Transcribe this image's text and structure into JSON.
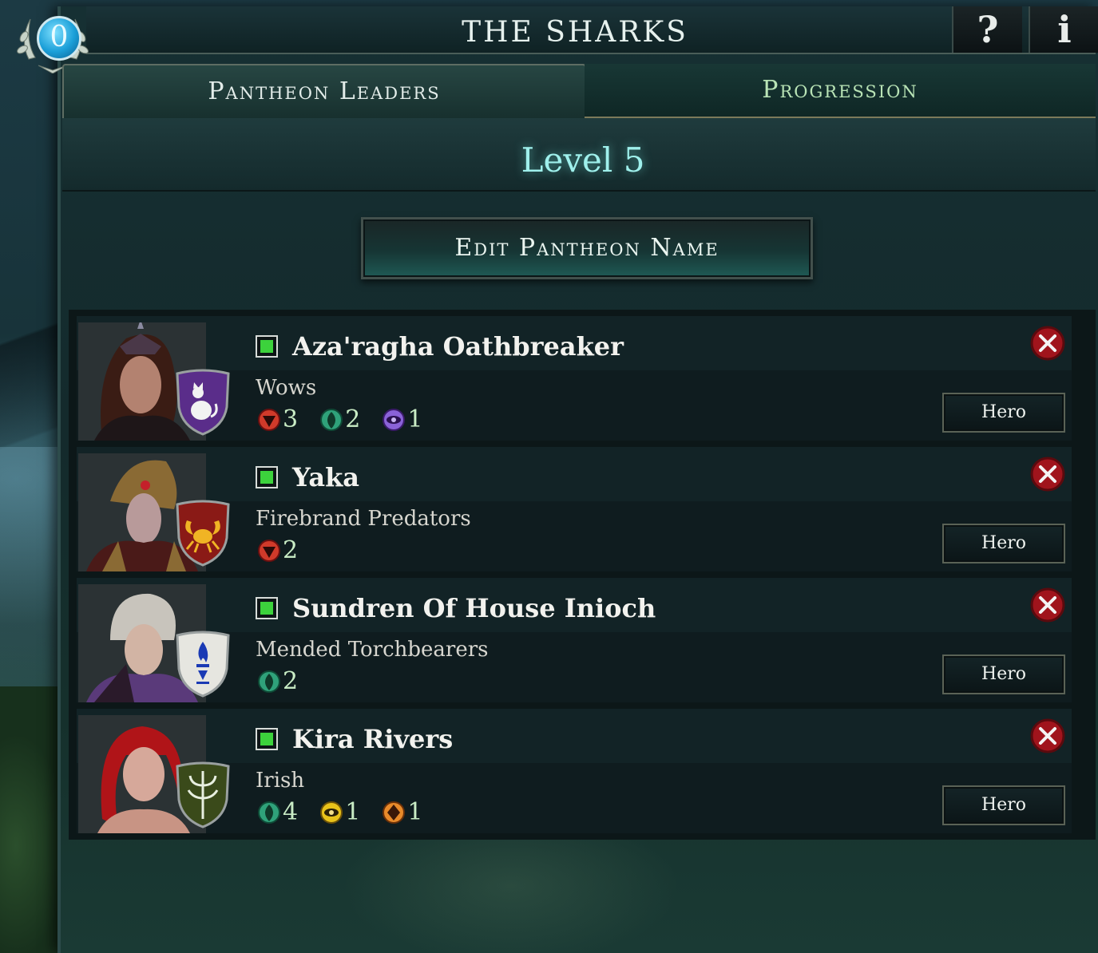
{
  "header": {
    "title": "The Sharks",
    "help_glyph": "?",
    "info_glyph": "i",
    "badge_value": "0"
  },
  "tabs": [
    {
      "label": "Pantheon Leaders",
      "selected": true
    },
    {
      "label": "Progression",
      "selected": false
    }
  ],
  "level": "Level 5",
  "edit_button": "Edit Pantheon Name",
  "leaders": [
    {
      "name": "Aza'ragha Oathbreaker",
      "faction": "Wows",
      "checked": true,
      "hero_label": "Hero",
      "shield_color": "#5a2d8a",
      "shield_icon": "cat-icon",
      "stats": [
        {
          "icon": "chaos-affinity-icon",
          "value": "3"
        },
        {
          "icon": "nature-affinity-icon",
          "value": "2"
        },
        {
          "icon": "astral-affinity-icon",
          "value": "1"
        }
      ]
    },
    {
      "name": "Yaka",
      "faction": "Firebrand Predators",
      "checked": true,
      "hero_label": "Hero",
      "shield_color": "#8a1a16",
      "shield_icon": "crab-icon",
      "stats": [
        {
          "icon": "chaos-affinity-icon",
          "value": "2"
        }
      ]
    },
    {
      "name": "Sundren Of House Inioch",
      "faction": "Mended Torchbearers",
      "checked": true,
      "hero_label": "Hero",
      "shield_color": "#e6e6e0",
      "shield_icon": "torch-icon",
      "stats": [
        {
          "icon": "nature-affinity-icon",
          "value": "2"
        }
      ]
    },
    {
      "name": "Kira Rivers",
      "faction": "Irish",
      "checked": true,
      "hero_label": "Hero",
      "shield_color": "#3a4a1a",
      "shield_icon": "branch-icon",
      "stats": [
        {
          "icon": "nature-affinity-icon",
          "value": "4"
        },
        {
          "icon": "order-affinity-icon",
          "value": "1"
        },
        {
          "icon": "materium-affinity-icon",
          "value": "1"
        }
      ]
    }
  ],
  "colors": {
    "accent_teal": "#9ff0ec",
    "check_green": "#3cd23c",
    "remove_red": "#a0141c"
  }
}
